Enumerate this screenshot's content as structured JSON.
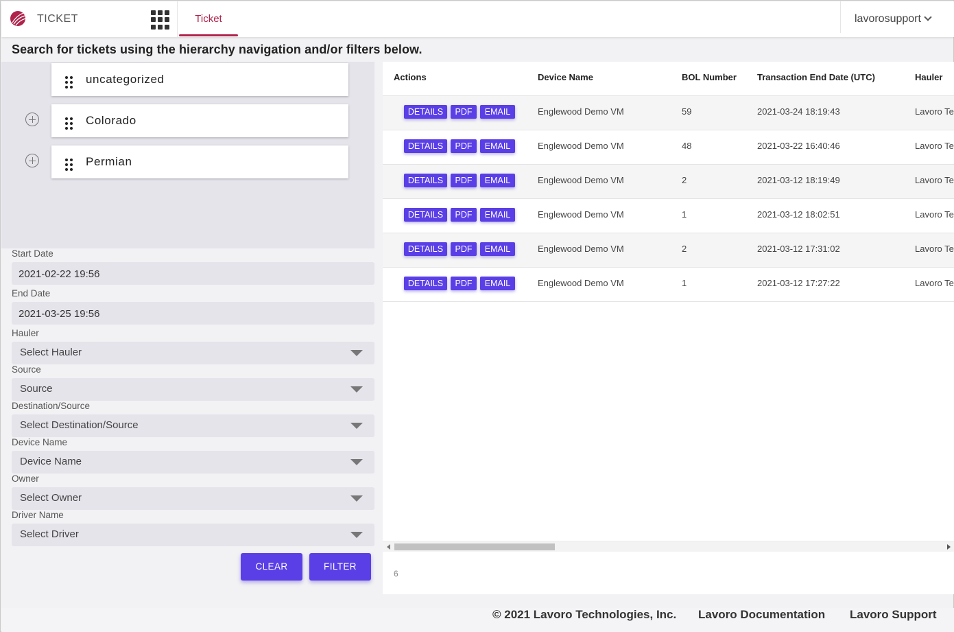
{
  "header": {
    "app_name": "TICKET",
    "tab_label": "Ticket",
    "user_name": "lavorosupport"
  },
  "headline": "Search for tickets using the hierarchy navigation and/or filters below.",
  "hierarchy": {
    "nodes": [
      {
        "label": "uncategorized",
        "expandable": false
      },
      {
        "label": "Colorado",
        "expandable": true
      },
      {
        "label": "Permian",
        "expandable": true
      }
    ]
  },
  "filters": {
    "start_date_label": "Start Date",
    "start_date_value": "2021-02-22 19:56",
    "end_date_label": "End Date",
    "end_date_value": "2021-03-25 19:56",
    "hauler_label": "Hauler",
    "hauler_value": "Select Hauler",
    "source_label": "Source",
    "source_value": "Source",
    "destination_label": "Destination/Source",
    "destination_value": "Select Destination/Source",
    "device_label": "Device Name",
    "device_value": "Device Name",
    "owner_label": "Owner",
    "owner_value": "Select Owner",
    "driver_label": "Driver Name",
    "driver_value": "Select Driver",
    "clear_label": "CLEAR",
    "filter_label": "FILTER"
  },
  "table": {
    "headers": [
      "Actions",
      "Device Name",
      "BOL Number",
      "Transaction End Date (UTC)",
      "Hauler"
    ],
    "action_labels": {
      "details": "DETAILS",
      "pdf": "PDF",
      "email": "EMAIL"
    },
    "rows": [
      {
        "device": "Englewood Demo VM",
        "bol": "59",
        "date": "2021-03-24 18:19:43",
        "hauler": "Lavoro Te"
      },
      {
        "device": "Englewood Demo VM",
        "bol": "48",
        "date": "2021-03-22 16:40:46",
        "hauler": "Lavoro Te"
      },
      {
        "device": "Englewood Demo VM",
        "bol": "2",
        "date": "2021-03-12 18:19:49",
        "hauler": "Lavoro Te"
      },
      {
        "device": "Englewood Demo VM",
        "bol": "1",
        "date": "2021-03-12 18:02:51",
        "hauler": "Lavoro Te"
      },
      {
        "device": "Englewood Demo VM",
        "bol": "2",
        "date": "2021-03-12 17:31:02",
        "hauler": "Lavoro Te"
      },
      {
        "device": "Englewood Demo VM",
        "bol": "1",
        "date": "2021-03-12 17:27:22",
        "hauler": "Lavoro Te"
      }
    ],
    "row_count": "6"
  },
  "footer": {
    "copyright": "© 2021 Lavoro Technologies, Inc.",
    "docs_link": "Lavoro Documentation",
    "support_link": "Lavoro Support"
  },
  "colors": {
    "brand": "#b0234b",
    "button": "#5b3fe6"
  },
  "icons": {
    "logo": "lavoro-logo-icon",
    "apps": "apps-grid-icon",
    "user_menu": "chevron-down-icon",
    "drag": "drag-handle-icon",
    "expand": "expand-plus-icon",
    "select": "caret-down-icon"
  }
}
